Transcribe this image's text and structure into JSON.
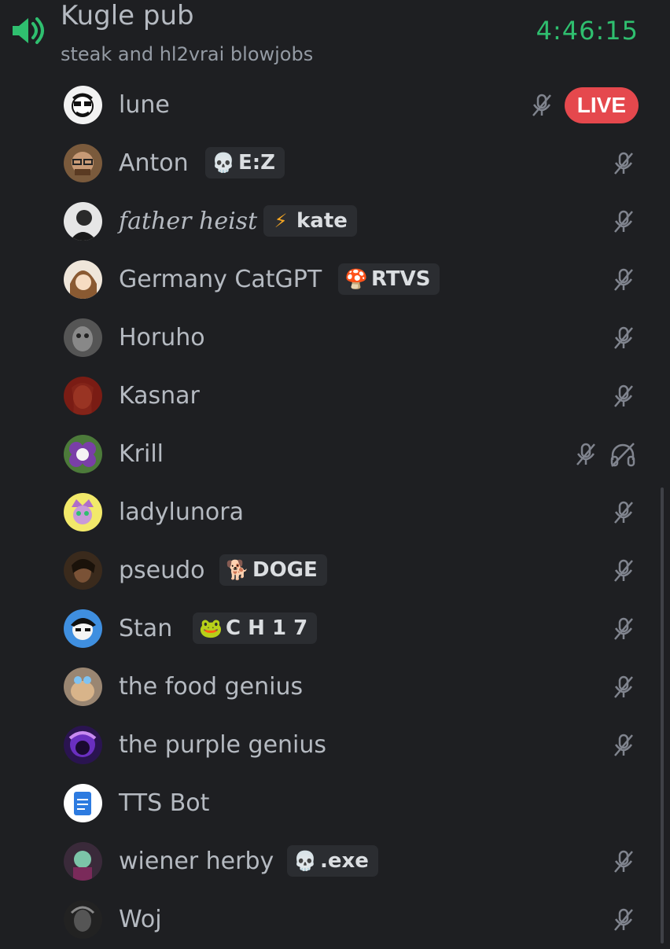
{
  "channel": {
    "name": "Kugle pub",
    "status": "steak and hl2vrai blowjobs",
    "elapsed": "4:46:15"
  },
  "colors": {
    "background": "#1e1f22",
    "timer": "#2fbf6f",
    "live": "#e5484d",
    "text": "#b5bac1"
  },
  "members": [
    {
      "name": "lune",
      "live": "LIVE",
      "muted": true
    },
    {
      "name": "Anton",
      "tag": "E:Z",
      "tag_icon": "skull-icon",
      "muted": true
    },
    {
      "name": "father heist",
      "tag": "kate",
      "tag_icon": "lightning-icon",
      "muted": true
    },
    {
      "name": "Germany CatGPT",
      "tag": "RTVS",
      "tag_icon": "mushroom-icon",
      "muted": true
    },
    {
      "name": "Horuho",
      "muted": true
    },
    {
      "name": "Kasnar",
      "muted": true
    },
    {
      "name": "Krill",
      "muted": true,
      "deafened": true
    },
    {
      "name": "ladylunora",
      "muted": true
    },
    {
      "name": "pseudo",
      "tag": "DOGE",
      "tag_icon": "doge-icon",
      "muted": true
    },
    {
      "name": "Stan",
      "tag": "C H 1 7",
      "tag_icon": "frog-icon",
      "muted": true
    },
    {
      "name": "the food genius",
      "muted": true
    },
    {
      "name": "the purple genius",
      "muted": true
    },
    {
      "name": "TTS Bot",
      "muted": false
    },
    {
      "name": "wiener herby",
      "tag": ".exe",
      "tag_icon": "skull-icon",
      "muted": true
    },
    {
      "name": "Woj",
      "muted": true
    }
  ]
}
